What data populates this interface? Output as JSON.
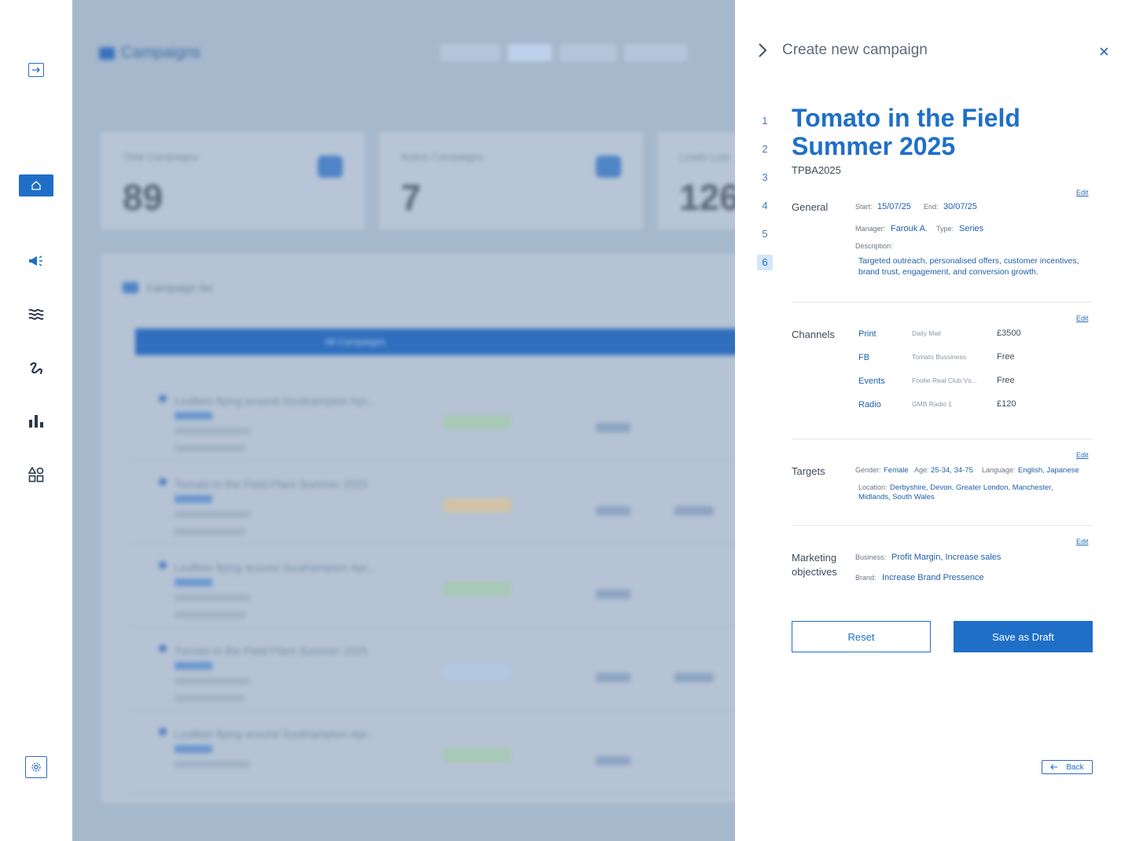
{
  "drawer": {
    "title": "Create new campaign",
    "steps": [
      "1",
      "2",
      "3",
      "4",
      "5",
      "6"
    ],
    "active_step": "6",
    "campaign_name": "Tomato in the Field Summer 2025",
    "campaign_code": "TPBA2025",
    "edit_label": "Edit",
    "general": {
      "label": "General",
      "start_label": "Start:",
      "start_value": "15/07/25",
      "end_label": "End:",
      "end_value": "30/07/25",
      "manager_label": "Manager:",
      "manager_value": "Farouk A.",
      "type_label": "Type:",
      "type_value": "Series",
      "description_label": "Description:",
      "description_value": "Targeted outreach, personalised offers, customer incentives, brand trust, engagement, and conversion growth."
    },
    "channels": {
      "label": "Channels",
      "items": [
        {
          "name": "Print",
          "desc": "Daily Mail",
          "cost": "£3500"
        },
        {
          "name": "FB",
          "desc": "Tomato Bussiness",
          "cost": "Free"
        },
        {
          "name": "Events",
          "desc": "Footie Real Club Vs...",
          "cost": "Free"
        },
        {
          "name": "Radio",
          "desc": "GMB Radio 1",
          "cost": "£120"
        }
      ]
    },
    "targets": {
      "label": "Targets",
      "gender_label": "Gender:",
      "gender_value": "Female",
      "age_label": "Age:",
      "age_value": "25-34, 34-75",
      "language_label": "Language:",
      "language_value": "English, Japanese",
      "location_label": "Location:",
      "location_value": "Derbyshire, Devon, Greater London, Manchester, Midlands, South Wales"
    },
    "objectives": {
      "label": "Marketing objectives",
      "business_label": "Business:",
      "business_value": "Profit Margin, Increase sales",
      "brand_label": "Brand:",
      "brand_value": "Increase Brand Pressence"
    },
    "reset_label": "Reset",
    "save_label": "Save as Draft",
    "back_label": "Back"
  },
  "background": {
    "page_title": "Campaigns",
    "stat_cards": [
      {
        "label": "Total Campaigns",
        "value": "89"
      },
      {
        "label": "Active Campaigns",
        "value": "7"
      },
      {
        "label": "Leads Lost",
        "value": "126"
      }
    ],
    "panel_title": "Campaign list",
    "bar_label": "All Campaigns",
    "row_titles": [
      "Leaflets flying around Southampton Apr...",
      "Tomato in the Field Plant Summer 2025",
      "Leaflets flying around Southampton Apr...",
      "Tomato in the Field Plant Summer 2025",
      "Leaflets flying around Southampton Apr..."
    ]
  },
  "colors": {
    "accent": "#1f6fc8",
    "overlay": "#a6b8cc"
  }
}
